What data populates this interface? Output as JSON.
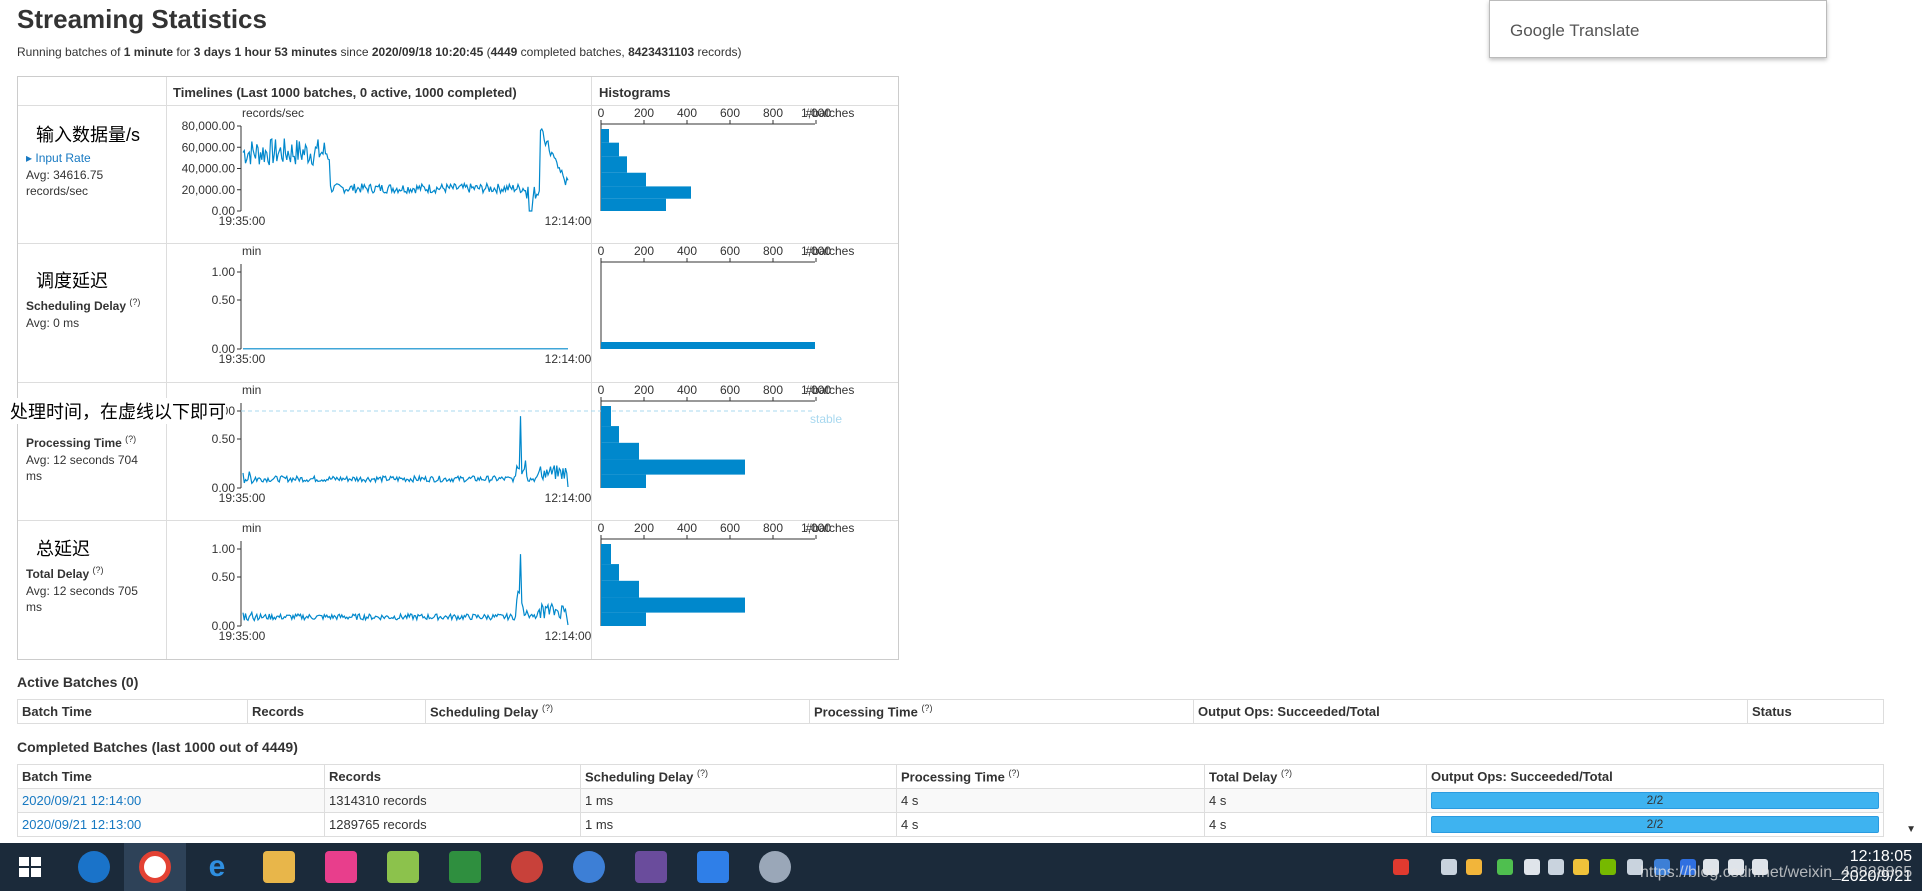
{
  "page": {
    "title": "Streaming Statistics",
    "summary": {
      "p1": "Running batches of ",
      "interval": "1 minute",
      "p2": " for ",
      "dur1": "3 days 1 hour 53 minutes",
      "p3": " since ",
      "since": "2020/09/18 10:20:45",
      "p4": " (",
      "completed": "4449",
      "p5": " completed batches, ",
      "records": "8423431103",
      "p6": " records)"
    }
  },
  "google_translate": {
    "label": "Google Translate"
  },
  "stats_table": {
    "timelines_header": "Timelines (Last 1000 batches, 0 active, 1000 completed)",
    "histograms_header": "Histograms",
    "time_start": "19:35:00",
    "time_end": "12:14:00",
    "hist_ticks": [
      "0",
      "200",
      "400",
      "600",
      "800",
      "1,000"
    ],
    "hist_unit": "#batches",
    "stable_label": "stable",
    "rows": [
      {
        "annotation_cn": "输入数据量/s",
        "name": "Input Rate",
        "avg": "Avg: 34616.75 records/sec",
        "unit": "records/sec",
        "y_ticks": [
          "80,000.00",
          "60,000.00",
          "40,000.00",
          "20,000.00",
          "0.00"
        ]
      },
      {
        "annotation_cn": "调度延迟",
        "name": "Scheduling Delay",
        "help": "(?)",
        "avg": "Avg: 0 ms",
        "unit": "min",
        "y_ticks": [
          "1.00",
          "0.50",
          "0.00"
        ]
      },
      {
        "annotation_cn": "处理时间，在虚线以下即可",
        "name": "Processing Time",
        "help": "(?)",
        "avg": "Avg: 12 seconds 704 ms",
        "unit": "min",
        "y_ticks": [
          "1.00",
          "0.50",
          "0.00"
        ]
      },
      {
        "annotation_cn": "总延迟",
        "name": "Total Delay",
        "help": "(?)",
        "avg": "Avg: 12 seconds 705 ms",
        "unit": "min",
        "y_ticks": [
          "1.00",
          "0.50",
          "0.00"
        ]
      }
    ]
  },
  "active_batches": {
    "title": "Active Batches (0)",
    "columns": [
      "Batch Time",
      "Records",
      "Scheduling Delay",
      "Processing Time",
      "Output Ops: Succeeded/Total",
      "Status"
    ],
    "help": "(?)"
  },
  "completed_batches": {
    "title": "Completed Batches (last 1000 out of 4449)",
    "columns": [
      "Batch Time",
      "Records",
      "Scheduling Delay",
      "Processing Time",
      "Total Delay",
      "Output Ops: Succeeded/Total"
    ],
    "help": "(?)",
    "rows": [
      {
        "time": "2020/09/21 12:14:00",
        "records": "1314310 records",
        "sched": "1 ms",
        "proc": "4 s",
        "total": "4 s",
        "ops": "2/2"
      },
      {
        "time": "2020/09/21 12:13:00",
        "records": "1289765 records",
        "sched": "1 ms",
        "proc": "4 s",
        "total": "4 s",
        "ops": "2/2"
      }
    ]
  },
  "taskbar": {
    "clock_time": "12:18:05",
    "clock_date": "2020/9/21",
    "watermark": "https://blog.csdn.net/weixin_43828865"
  },
  "colors": {
    "accent": "#0088cc",
    "link": "#1779c2",
    "taskbar": "#1b2a3a"
  }
}
